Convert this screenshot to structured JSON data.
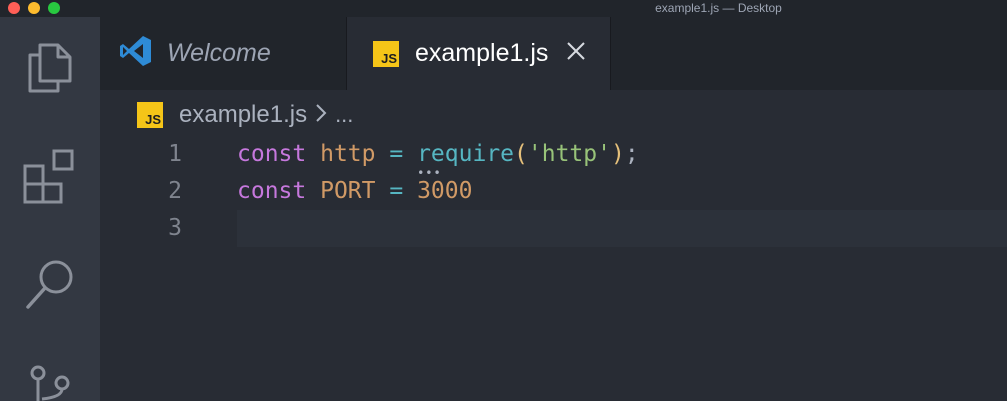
{
  "window": {
    "title": "example1.js — Desktop"
  },
  "activity_bar": {
    "icons": [
      "files-icon",
      "extensions-icon",
      "search-icon",
      "source-control-icon"
    ]
  },
  "tabs": [
    {
      "label": "Welcome",
      "icon": "vscode-logo-icon",
      "active": false
    },
    {
      "label": "example1.js",
      "icon": "js-file-icon",
      "badge": "JS",
      "active": true
    }
  ],
  "breadcrumb": {
    "badge": "JS",
    "file": "example1.js",
    "more": "..."
  },
  "editor": {
    "lines": [
      {
        "number": "1",
        "tokens": [
          "const",
          " ",
          "http",
          " ",
          "=",
          " ",
          "require",
          "(",
          "'http'",
          ")",
          ";"
        ]
      },
      {
        "number": "2",
        "tokens": [
          "const",
          " ",
          "PORT",
          " ",
          "=",
          " ",
          "3000"
        ]
      },
      {
        "number": "3",
        "tokens": []
      }
    ],
    "current_line": 3
  },
  "colors": {
    "background": "#282c34",
    "activity_bar": "#333842",
    "tab_bar": "#21252b",
    "keyword": "#c678dd",
    "variable": "#d19a66",
    "operator": "#56b6c2",
    "string": "#98c379",
    "number": "#d19a66",
    "js_badge": "#f5c518"
  }
}
